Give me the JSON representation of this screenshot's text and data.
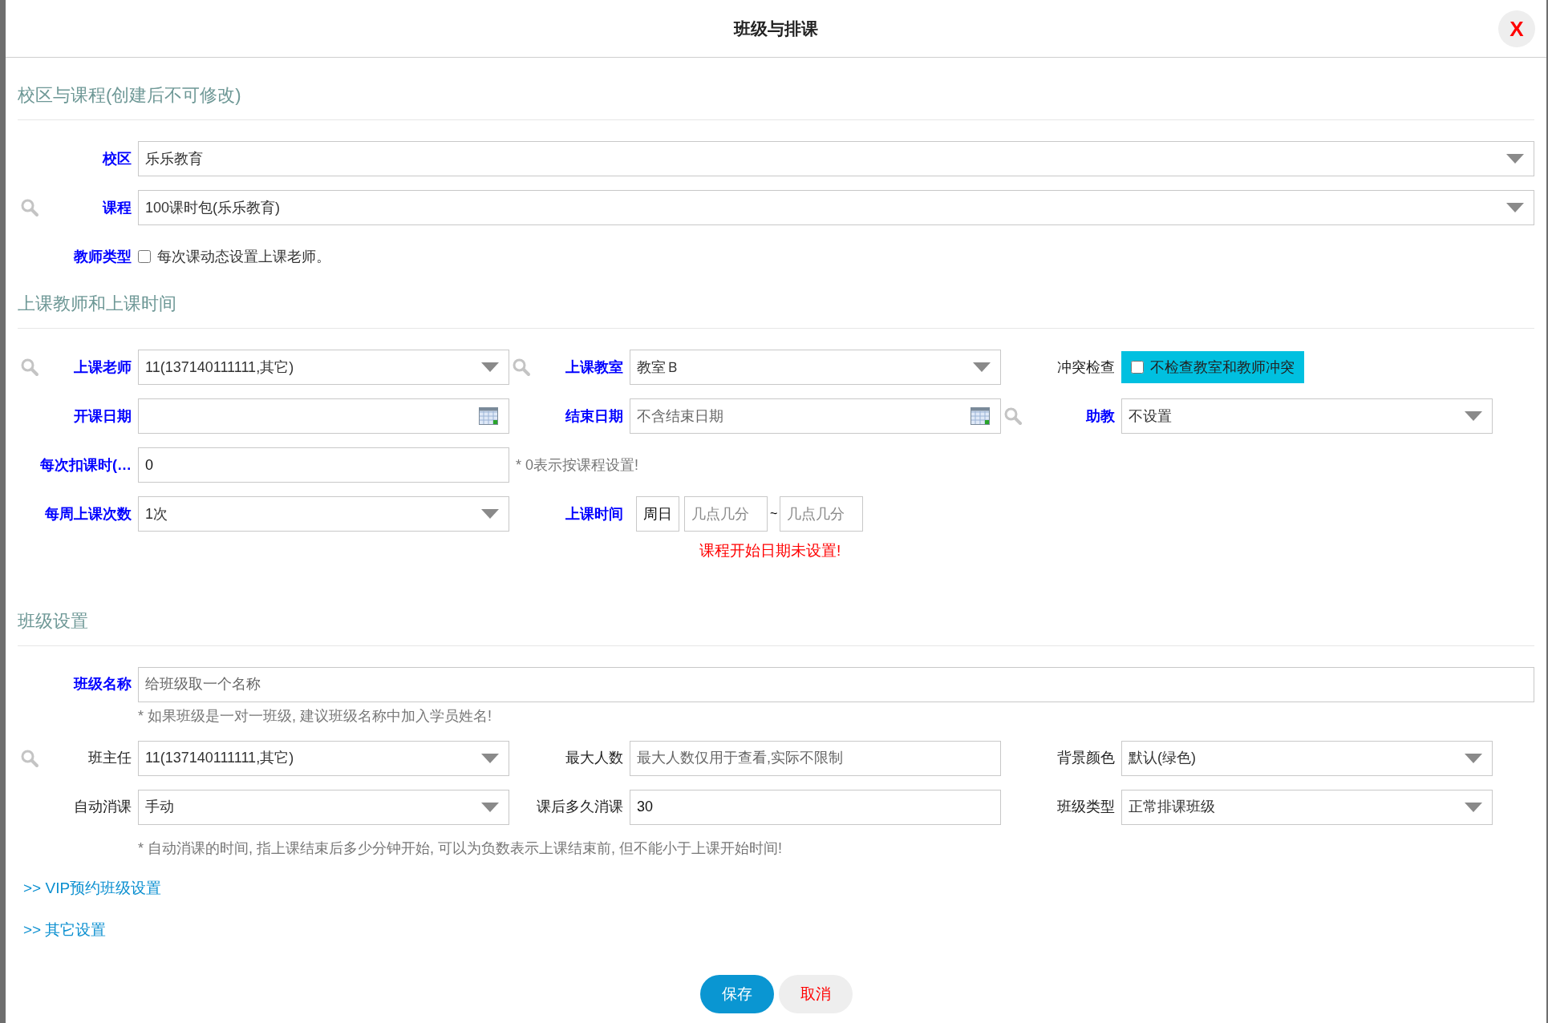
{
  "dialog": {
    "title": "班级与排课",
    "close": "X"
  },
  "sections": [
    {
      "title": "校区与课程(创建后不可修改)",
      "rows": [
        {
          "cells": [
            {
              "label": "校区",
              "required": true,
              "search": false,
              "kind": "select",
              "value": "乐乐教育"
            }
          ]
        },
        {
          "cells": [
            {
              "label": "课程",
              "required": true,
              "search": true,
              "kind": "select",
              "value": "100课时包(乐乐教育)"
            }
          ]
        },
        {
          "cells": [
            {
              "label": "教师类型",
              "required": true,
              "search": false,
              "kind": "checkbox",
              "text": "每次课动态设置上课老师。",
              "checked": false,
              "highlighted": false
            }
          ]
        }
      ]
    },
    {
      "title": "上课教师和上课时间",
      "rows": [
        {
          "cells": [
            {
              "label": "上课老师",
              "required": true,
              "search": true,
              "kind": "select",
              "value": "11(137140111111,其它)"
            },
            {
              "label": "上课教室",
              "required": true,
              "search": true,
              "kind": "select",
              "value": "教室Ｂ"
            },
            {
              "label": "冲突检查",
              "required": false,
              "search": false,
              "kind": "checkbox",
              "text": "不检查教室和教师冲突",
              "checked": false,
              "highlighted": true
            }
          ]
        },
        {
          "cells": [
            {
              "label": "开课日期",
              "required": true,
              "search": false,
              "kind": "date"
            },
            {
              "label": "结束日期",
              "required": true,
              "search": false,
              "kind": "date",
              "placeholder": "不含结束日期"
            },
            {
              "label": "助教",
              "required": true,
              "search": true,
              "kind": "select",
              "value": "不设置"
            }
          ]
        },
        {
          "cells": [
            {
              "label": "每次扣课时(…",
              "required": true,
              "search": false,
              "kind": "input",
              "value": "0"
            },
            {
              "kind": "note",
              "text": "* 0表示按课程设置!"
            }
          ]
        },
        {
          "cells": [
            {
              "label": "每周上课次数",
              "required": true,
              "search": false,
              "kind": "select",
              "value": "1次"
            },
            {
              "label": "上课时间",
              "required": true,
              "search": false,
              "kind": "time",
              "day": "周日",
              "start_placeholder": "几点几分",
              "separator": "~",
              "end_placeholder": "几点几分"
            }
          ]
        }
      ],
      "error": "课程开始日期未设置!"
    },
    {
      "title": "班级设置",
      "rows": [
        {
          "cells": [
            {
              "label": "班级名称",
              "required": true,
              "search": false,
              "kind": "input",
              "placeholder": "给班级取一个名称"
            }
          ],
          "note": "* 如果班级是一对一班级, 建议班级名称中加入学员姓名!"
        },
        {
          "cells": [
            {
              "label": "班主任",
              "required": false,
              "search": true,
              "kind": "select",
              "value": "11(137140111111,其它)"
            },
            {
              "label": "最大人数",
              "required": false,
              "search": false,
              "kind": "input",
              "placeholder": "最大人数仅用于查看,实际不限制"
            },
            {
              "label": "背景颜色",
              "required": false,
              "search": false,
              "kind": "select",
              "value": "默认(绿色)"
            }
          ]
        },
        {
          "cells": [
            {
              "label": "自动消课",
              "required": false,
              "search": false,
              "kind": "select",
              "value": "手动"
            },
            {
              "label": "课后多久消课",
              "required": false,
              "search": false,
              "kind": "input",
              "value": "30"
            },
            {
              "label": "班级类型",
              "required": false,
              "search": false,
              "kind": "select",
              "value": "正常排课班级"
            }
          ],
          "note": "* 自动消课的时间, 指上课结束后多少分钟开始, 可以为负数表示上课结束前, 但不能小于上课开始时间!"
        }
      ]
    }
  ],
  "links": [
    ">> VIP预约班级设置",
    ">> 其它设置"
  ],
  "buttons": [
    {
      "label": "保存",
      "kind": "primary"
    },
    {
      "label": "取消",
      "kind": "secondary"
    }
  ]
}
